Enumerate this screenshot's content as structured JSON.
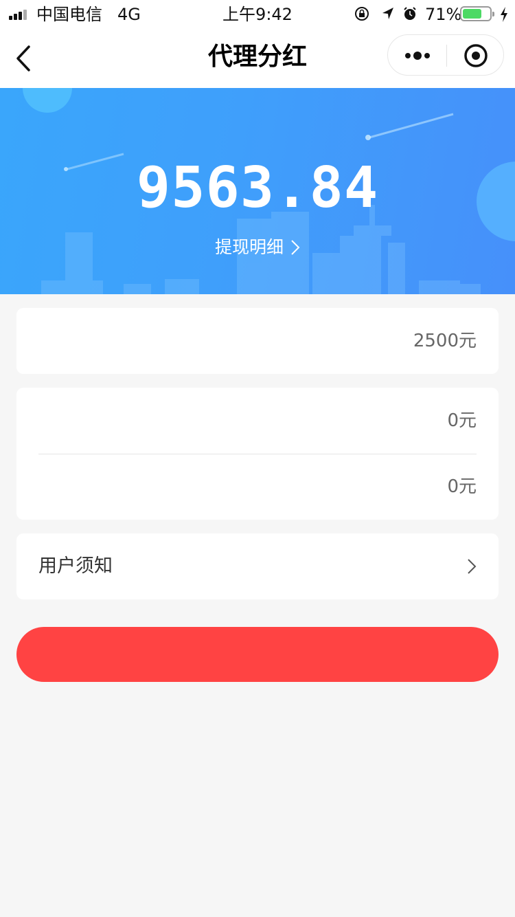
{
  "status_bar": {
    "carrier": "中国电信",
    "network": "4G",
    "time": "上午9:42",
    "battery_percent": "71%",
    "battery_level": 0.71
  },
  "nav": {
    "title": "代理分红",
    "icons": [
      "back-chevron-icon",
      "more-dots-icon",
      "close-target-icon"
    ]
  },
  "banner": {
    "amount": "9563.84",
    "detail_link": "提现明细"
  },
  "cards": {
    "card1_value": "2500元",
    "card2_values": [
      "0元",
      "0元"
    ]
  },
  "notice": {
    "label": "用户须知"
  },
  "colors": {
    "banner_start": "#3aa6fb",
    "banner_end": "#4690fa",
    "button": "#ff4343",
    "battery": "#4cd964"
  }
}
